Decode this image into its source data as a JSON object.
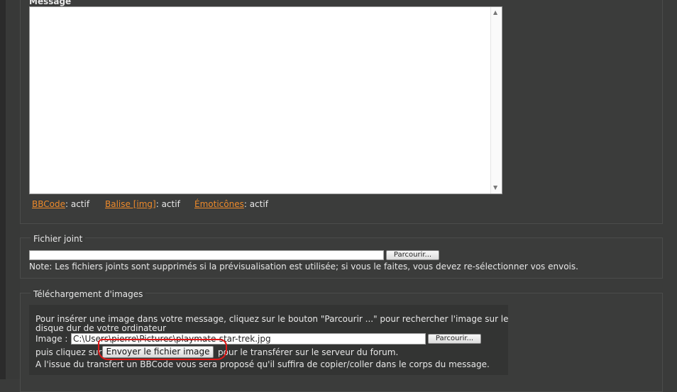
{
  "message": {
    "legend": "Message",
    "status": [
      {
        "link": "BBCode",
        "value": ": actif"
      },
      {
        "link": "Balise [img]",
        "value": ": actif"
      },
      {
        "link": "Émoticônes",
        "value": ": actif"
      }
    ]
  },
  "attachment": {
    "legend": "Fichier joint",
    "browse_label": "Parcourir...",
    "note": "Note: Les fichiers joints sont supprimés si la prévisualisation est utilisée; si vous le faites, vous devez re-sélectionner vos envois."
  },
  "image_upload": {
    "legend": "Téléchargement d'images",
    "intro_line1": "Pour insérer une image dans votre message, cliquez sur le bouton \"Parcourir ...\" pour rechercher l'image sur le",
    "intro_line2": "disque dur de votre ordinateur",
    "image_label": "Image :",
    "image_path": "C:\\Users\\pierre\\Pictures\\playmate-star-trek.jpg",
    "browse_label": "Parcourir...",
    "then_click": "puis cliquez sur",
    "send_label": "Envoyer le fichier image",
    "after_send": "pour le transférer sur le serveur du forum.",
    "result_text": "A l'issue du transfert un BBCode vous sera proposé qu'il suffira de copier/coller dans le corps du message.",
    "highlight_color": "#e01818"
  }
}
